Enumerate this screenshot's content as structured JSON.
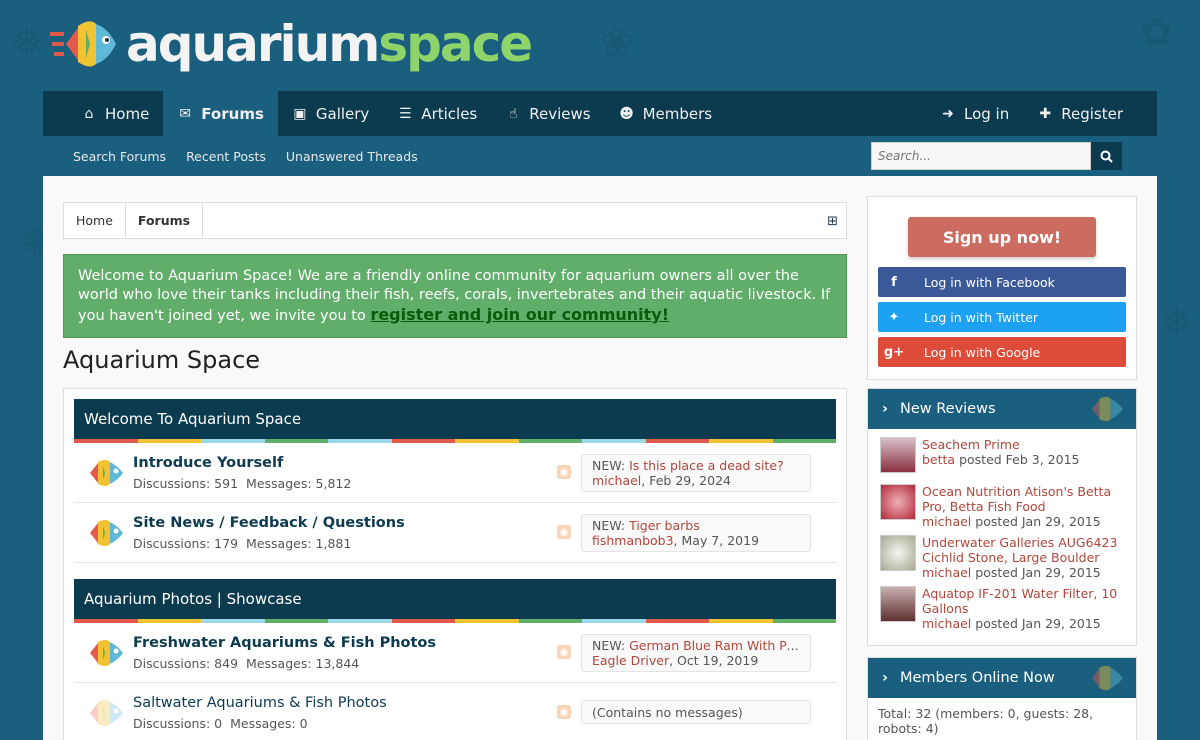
{
  "brand": {
    "word1": "aquarium",
    "word2": "space"
  },
  "nav": {
    "home": "Home",
    "forums": "Forums",
    "gallery": "Gallery",
    "articles": "Articles",
    "reviews": "Reviews",
    "members": "Members",
    "login": "Log in",
    "register": "Register"
  },
  "subnav": {
    "search_forums": "Search Forums",
    "recent_posts": "Recent Posts",
    "unanswered": "Unanswered Threads",
    "search_placeholder": "Search..."
  },
  "breadcrumb": {
    "home": "Home",
    "forums": "Forums"
  },
  "notice": {
    "text": "Welcome to Aquarium Space! We are a friendly online community for aquarium owners all over the world who love their tanks including their fish, reefs, corals, invertebrates and their aquatic livestock. If you haven't joined yet, we invite you to ",
    "link": "register and join our community!"
  },
  "page_title": "Aquarium Space",
  "categories": [
    {
      "title": "Welcome To Aquarium Space",
      "nodes": [
        {
          "title": "Introduce Yourself",
          "discussions": "Discussions: 591",
          "messages": "Messages: 5,812",
          "lp_prefix": "NEW: ",
          "lp_title": "Is this place a dead site?",
          "lp_user": "michael",
          "lp_date": ", Feb 29, 2024"
        },
        {
          "title": "Site News / Feedback / Questions",
          "discussions": "Discussions: 179",
          "messages": "Messages: 1,881",
          "lp_prefix": "NEW: ",
          "lp_title": "Tiger barbs",
          "lp_user": "fishmanbob3",
          "lp_date": ", May 7, 2019"
        }
      ]
    },
    {
      "title": "Aquarium Photos | Showcase",
      "nodes": [
        {
          "title": "Freshwater Aquariums & Fish Photos",
          "discussions": "Discussions: 849",
          "messages": "Messages: 13,844",
          "lp_prefix": "NEW: ",
          "lp_title": "German Blue Ram With Pope...",
          "lp_user": "Eagle Driver",
          "lp_date": ", Oct 19, 2019"
        },
        {
          "title": "Saltwater Aquariums & Fish Photos",
          "discussions": "Discussions: 0",
          "messages": "Messages: 0",
          "empty": "(Contains no messages)"
        }
      ]
    }
  ],
  "sidebar": {
    "signup": "Sign up now!",
    "facebook": "Log in with Facebook",
    "twitter": "Log in with Twitter",
    "google": "Log in with Google",
    "new_reviews_title": "New Reviews",
    "reviews": [
      {
        "title": "Seachem Prime",
        "user": "betta",
        "meta": " posted Feb 3, 2015"
      },
      {
        "title": "Ocean Nutrition Atison's Betta Pro, Betta Fish Food",
        "user": "michael",
        "meta": " posted Jan 29, 2015"
      },
      {
        "title": "Underwater Galleries AUG6423 Cichlid Stone, Large Boulder",
        "user": "michael",
        "meta": " posted Jan 29, 2015"
      },
      {
        "title": "Aquatop IF-201 Water Filter, 10 Gallons",
        "user": "michael",
        "meta": " posted Jan 29, 2015"
      }
    ],
    "members_online_title": "Members Online Now",
    "members_online_text": "Total: 32 (members: 0, guests: 28, robots: 4)"
  },
  "colors": {
    "nav_dark": "#0c3a4e",
    "nav_mid": "#1b5f7e",
    "notice_green": "#61ae6b",
    "link_red": "#b0463c",
    "signup_red": "#cc6b60"
  }
}
